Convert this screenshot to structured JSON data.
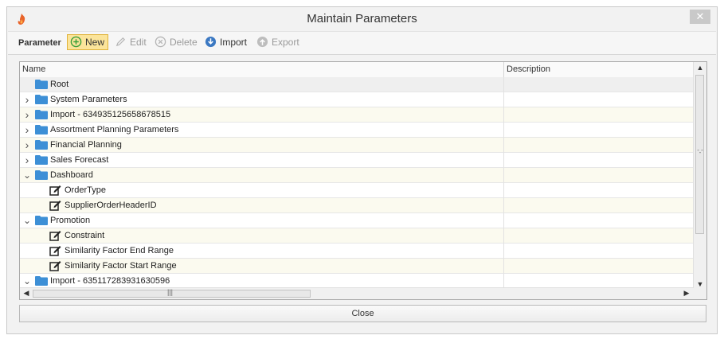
{
  "window": {
    "title": "Maintain Parameters",
    "close_glyph": "✕",
    "app_icon": "flame-logo-icon"
  },
  "toolbar": {
    "label": "Parameter",
    "buttons": [
      {
        "label": "New",
        "icon": "plus-circle-icon",
        "state": "active"
      },
      {
        "label": "Edit",
        "icon": "pencil-icon",
        "state": "disabled"
      },
      {
        "label": "Delete",
        "icon": "x-circle-icon",
        "state": "disabled"
      },
      {
        "label": "Import",
        "icon": "download-circle-icon",
        "state": "enabled"
      },
      {
        "label": "Export",
        "icon": "upload-circle-icon",
        "state": "disabled"
      }
    ]
  },
  "grid": {
    "columns": [
      "Name",
      "Description"
    ],
    "rows": [
      {
        "label": "Root",
        "type": "folder",
        "level": 0,
        "expander": "none"
      },
      {
        "label": "System Parameters",
        "type": "folder",
        "level": 0,
        "expander": "collapsed"
      },
      {
        "label": "Import - 634935125658678515",
        "type": "folder",
        "level": 0,
        "expander": "collapsed"
      },
      {
        "label": "Assortment Planning Parameters",
        "type": "folder",
        "level": 0,
        "expander": "collapsed"
      },
      {
        "label": "Financial Planning",
        "type": "folder",
        "level": 0,
        "expander": "collapsed"
      },
      {
        "label": "Sales Forecast",
        "type": "folder",
        "level": 0,
        "expander": "collapsed"
      },
      {
        "label": "Dashboard",
        "type": "folder",
        "level": 0,
        "expander": "expanded"
      },
      {
        "label": "OrderType",
        "type": "parameter",
        "level": 1,
        "expander": "none"
      },
      {
        "label": "SupplierOrderHeaderID",
        "type": "parameter",
        "level": 1,
        "expander": "none"
      },
      {
        "label": "Promotion",
        "type": "folder",
        "level": 0,
        "expander": "expanded"
      },
      {
        "label": "Constraint",
        "type": "parameter",
        "level": 1,
        "expander": "none"
      },
      {
        "label": "Similarity Factor End Range",
        "type": "parameter",
        "level": 1,
        "expander": "none"
      },
      {
        "label": "Similarity Factor Start Range",
        "type": "parameter",
        "level": 1,
        "expander": "none"
      },
      {
        "label": "Import - 635117283931630596",
        "type": "folder",
        "level": 0,
        "expander": "expanded"
      }
    ]
  },
  "footer": {
    "close_label": "Close"
  },
  "colors": {
    "folder": "#3d8fd6",
    "active_button_bg": "#fbe49a",
    "active_button_border": "#e0b33b",
    "new_icon": "#3aa03a",
    "import_icon": "#3b78c2"
  }
}
